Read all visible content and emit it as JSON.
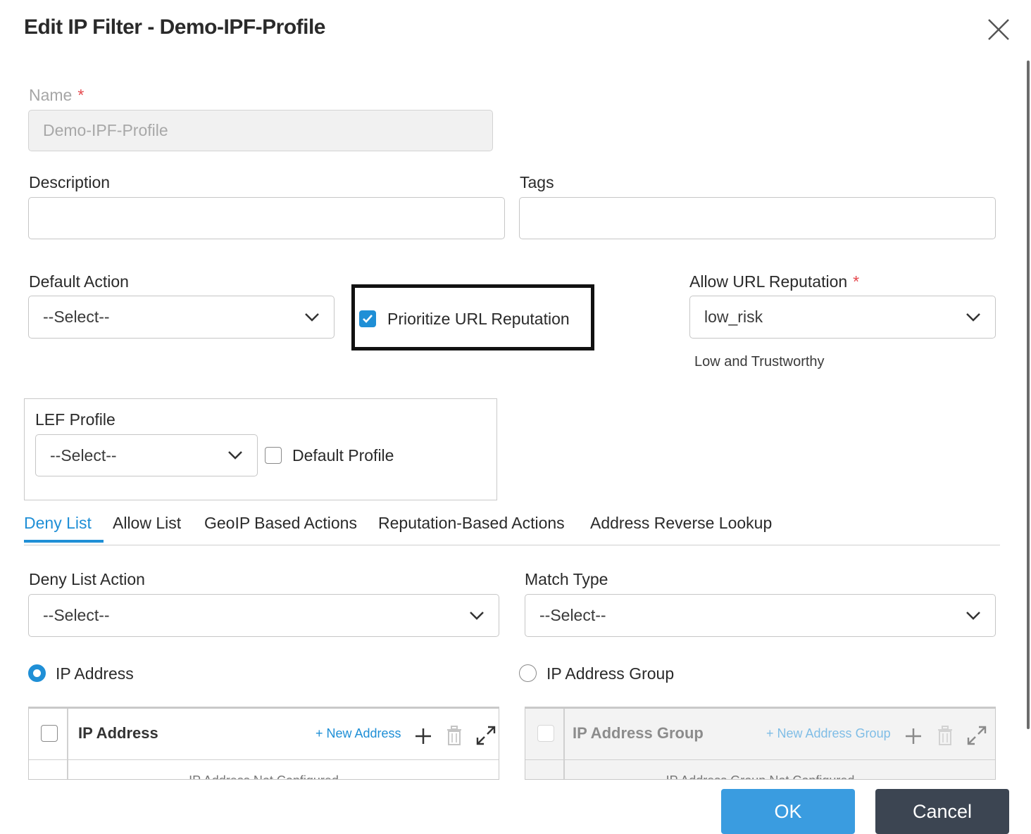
{
  "dialog": {
    "title": "Edit IP Filter - Demo-IPF-Profile",
    "icons": {
      "close": "close-icon"
    }
  },
  "name": {
    "label": "Name",
    "required_mark": "*",
    "value": "Demo-IPF-Profile"
  },
  "description": {
    "label": "Description",
    "value": ""
  },
  "tags": {
    "label": "Tags",
    "value": ""
  },
  "default_action": {
    "label": "Default Action",
    "value": "--Select--"
  },
  "prioritize_url_reputation": {
    "label": "Prioritize URL Reputation",
    "checked": true
  },
  "allow_url_reputation": {
    "label": "Allow URL Reputation",
    "required_mark": "*",
    "value": "low_risk",
    "hint": "Low and Trustworthy"
  },
  "lef_profile": {
    "label": "LEF Profile",
    "value": "--Select--",
    "default_profile_label": "Default Profile",
    "default_profile_checked": false
  },
  "tabs": [
    {
      "label": "Deny List",
      "active": true
    },
    {
      "label": "Allow List",
      "active": false
    },
    {
      "label": "GeoIP Based Actions",
      "active": false
    },
    {
      "label": "Reputation-Based Actions",
      "active": false
    },
    {
      "label": "Address Reverse Lookup",
      "active": false
    }
  ],
  "deny_list": {
    "action": {
      "label": "Deny List Action",
      "value": "--Select--"
    },
    "match_type": {
      "label": "Match Type",
      "value": "--Select--"
    },
    "radio": {
      "ip_address": {
        "label": "IP Address",
        "selected": true
      },
      "ip_address_group": {
        "label": "IP Address Group",
        "selected": false
      }
    },
    "ip_table": {
      "header": "IP Address",
      "new_link": "+ New Address",
      "empty_text": "IP Address Not Configured"
    },
    "group_table": {
      "header": "IP Address Group",
      "new_link": "+ New Address Group",
      "empty_text": "IP Address Group Not Configured"
    }
  },
  "footer": {
    "ok_label": "OK",
    "cancel_label": "Cancel"
  },
  "colors": {
    "accent": "#1f8fd6",
    "ok_button": "#3a9ce0",
    "cancel_button": "#3c4552",
    "required": "#e5484d"
  }
}
